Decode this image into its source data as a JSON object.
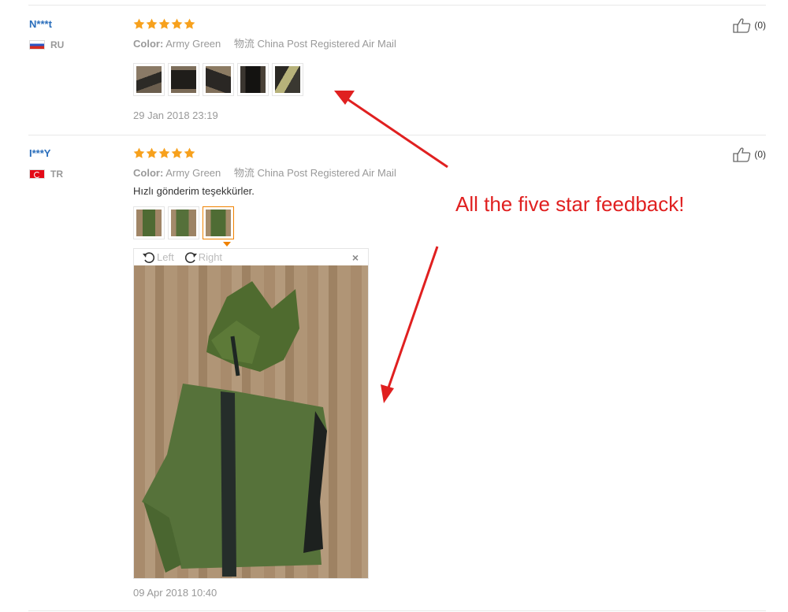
{
  "reviews": [
    {
      "user": "N***t",
      "country": "RU",
      "rating": 5,
      "color_label": "Color:",
      "color_value": "Army Green",
      "shipping_label": "物流",
      "shipping_value": "China Post Registered Air Mail",
      "text": "",
      "photo_count": 5,
      "date": "29 Jan 2018 23:19",
      "likes": "(0)"
    },
    {
      "user": "I***Y",
      "country": "TR",
      "rating": 5,
      "color_label": "Color:",
      "color_value": "Army Green",
      "shipping_label": "物流",
      "shipping_value": "China Post Registered Air Mail",
      "text": "Hızlı gönderim teşekkürler.",
      "photo_count": 3,
      "date": "09 Apr 2018 10:40",
      "likes": "(0)"
    }
  ],
  "viewer": {
    "rotate_left": "Left",
    "rotate_right": "Right",
    "close": "×"
  },
  "annotation": "All the five star feedback!",
  "colors": {
    "star": "#f7a11d",
    "username": "#2a6ebb",
    "annotation": "#e02020",
    "active_thumb": "#f08200"
  }
}
